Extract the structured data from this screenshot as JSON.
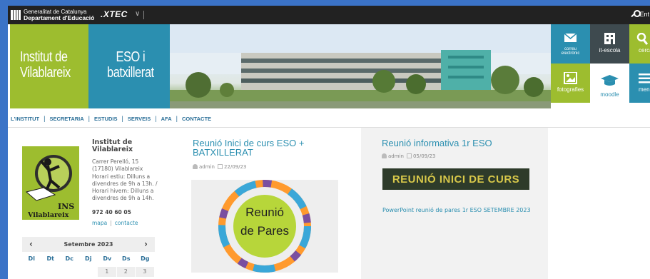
{
  "topbar": {
    "gencat_line1": "Generalitat de Catalunya",
    "gencat_line2": "Departament d'Educació",
    "xtec_label": ".XTEC",
    "xtec_caret": "∨",
    "login_label": "Ent"
  },
  "banner": {
    "school_name_line1": "Institut de",
    "school_name_line2": "Vilablareix",
    "levels_line1": "ESO i",
    "levels_line2": "batxillerat"
  },
  "tiles": {
    "mail": {
      "line1": "correu",
      "line2": "electrònic",
      "icon": "envelope-icon"
    },
    "it_escola": {
      "label": "it-escola",
      "icon": "building-icon"
    },
    "search": {
      "label": "cerca",
      "icon": "search-icon"
    },
    "photos": {
      "label": "fotografies",
      "icon": "image-icon"
    },
    "moodle": {
      "label": "moodle",
      "icon": "graduation-cap-icon"
    },
    "menu": {
      "label": "menú",
      "icon": "hamburger-icon"
    }
  },
  "nav": {
    "items": [
      "L'INSTITUT",
      "SECRETARIA",
      "ESTUDIS",
      "SERVEIS",
      "AFA",
      "CONTACTE"
    ]
  },
  "school": {
    "logo_line1": "INS",
    "logo_line2": "Vilablareix",
    "name_line1": "Institut de",
    "name_line2": "Vilablareix",
    "address_line1": "Carrer Perelló, 15",
    "address_line2": "(17180) Vilablareix",
    "hours_summer_line1": "Horari estiu: Dilluns a",
    "hours_summer_line2": "divendres de 9h a 13h. /",
    "hours_winter_line1": "Horari hivern: Dilluns a",
    "hours_winter_line2": "divendres de 9h a 14h.",
    "phone": "972 40 60 05",
    "link_map": "mapa",
    "link_sep": "|",
    "link_contact": "contacte"
  },
  "calendar": {
    "prev": "‹",
    "next": "›",
    "title": "Setembre 2023",
    "weekdays": [
      "Dl",
      "Dt",
      "Dc",
      "Dj",
      "Dv",
      "Ds",
      "Dg"
    ],
    "first_row": [
      "",
      "",
      "",
      "",
      "1",
      "2",
      "3"
    ]
  },
  "posts": [
    {
      "title": "Reunió Inici de curs ESO + BATXILLERAT",
      "author": "admin",
      "date": "22/09/23",
      "image_line1": "Reunió",
      "image_line2": "de Pares"
    },
    {
      "title": "Reunió informativa 1r ESO",
      "author": "admin",
      "date": "05/09/23",
      "badge": "REUNIÓ INICI DE CURS",
      "link": "PowerPoint reunió de pares 1r ESO SETEMBRE 2023"
    }
  ],
  "colors": {
    "green": "#9dbd2f",
    "blue": "#2b8fb0",
    "dark": "#222222",
    "slate": "#3e4a4f"
  }
}
